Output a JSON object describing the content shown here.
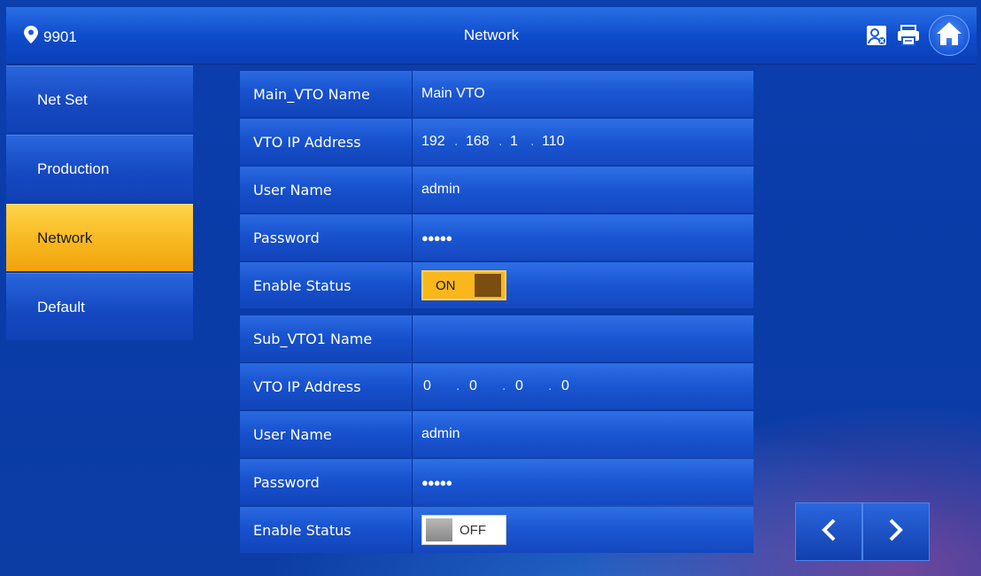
{
  "header": {
    "location": "9901",
    "title": "Network"
  },
  "icons": {
    "location": "map-pin-icon",
    "contacts": "contact-card-icon",
    "messages": "message-printer-icon",
    "home": "home-icon"
  },
  "sidebar": {
    "items": [
      {
        "label": "Net Set",
        "active": false
      },
      {
        "label": "Production",
        "active": false
      },
      {
        "label": "Network",
        "active": true
      },
      {
        "label": "Default",
        "active": false
      }
    ]
  },
  "main_vto": {
    "name_label": "Main_VTO Name",
    "name_value": "Main VTO",
    "ip_label": "VTO IP Address",
    "ip": [
      "192",
      "168",
      "1",
      "110"
    ],
    "user_label": "User Name",
    "user_value": "admin",
    "password_label": "Password",
    "password_value": "●●●●●",
    "status_label": "Enable Status",
    "status_value": "ON"
  },
  "sub_vto1": {
    "name_label": "Sub_VTO1 Name",
    "name_value": "",
    "ip_label": "VTO IP Address",
    "ip": [
      "0",
      "0",
      "0",
      "0"
    ],
    "user_label": "User Name",
    "user_value": "admin",
    "password_label": "Password",
    "password_value": "●●●●●",
    "status_label": "Enable Status",
    "status_value": "OFF"
  },
  "colors": {
    "accent": "#f7b51c",
    "panel_blue": "#1650cc",
    "background": "#0b3fae"
  }
}
